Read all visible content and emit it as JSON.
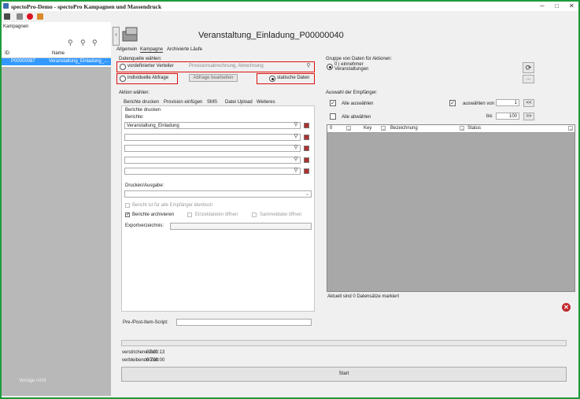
{
  "window": {
    "title": "spectoPro-Demo - spectoPro Kampagnen und Massendruck",
    "minimize": "─",
    "maximize": "□",
    "close": "✕"
  },
  "left": {
    "header": "Kampagnen",
    "col_id": "ID",
    "col_name": "Name",
    "row": {
      "id": "P00000087",
      "name": "Veranstaltung_Einladung_..."
    },
    "footer_link": "Verlage nicht"
  },
  "main": {
    "title": "Veranstaltung_Einladung_P00000040",
    "tabs": [
      "Allgemein",
      "Kampagne",
      "Archivierte Läufe"
    ]
  },
  "datasource": {
    "label": "Datenquelle wählen:",
    "opt_predefined": "vordefinierter Verteiler",
    "predefined_value": "Provisionsabrechnung, Abrechnung",
    "opt_individual": "individuelle Abfrage",
    "edit_query": "Abfrage bearbeiten",
    "opt_static": "statische Daten"
  },
  "group": {
    "label": "Gruppe von Daten für Aktionen:",
    "option": "0 | einnehmer Veranstaltungen",
    "refresh_icon": "refresh-icon",
    "more_button": "..."
  },
  "action": {
    "label": "Aktion wählen:",
    "subtabs": [
      "Berichte drucken",
      "Provision einfügen",
      "SMS",
      "Datei Upload",
      "Weiteres"
    ],
    "section_title": "Berichte drucken",
    "reports_label": "Berichte:",
    "reports": [
      "Veranstaltung_Einladung",
      "",
      "",
      "",
      ""
    ],
    "print_output_label": "Drucken/Ausgabe:",
    "identical_report": "Bericht ist für alle Empfänger identisch",
    "archive_reports": "Berichte archivieren",
    "open_single": "Einzeldateien öffnen",
    "open_collection": "Sammeldatei öffnen",
    "export_dir_label": "Exportverzeichnis:"
  },
  "recipients": {
    "label": "Auswahl der Empfänger:",
    "select_all": "Alle auswählen",
    "deselect_all": "Alle abwählen",
    "select_from_label": "auswählen von",
    "from_value": "1",
    "to_label": "bis",
    "to_value": "100",
    "prev_btn": "<<",
    "next_btn": ">>",
    "columns": [
      "0",
      "Key",
      "Bezeichnung",
      "Status"
    ],
    "status_text": "Aktuell sind 0 Datensätze markiert"
  },
  "bottom": {
    "script_label": "Pre-/Post-Item-Script:",
    "elapsed_label": "verstrichene Zeit:",
    "elapsed_value": "00:00:13",
    "remaining_label": "verbleibende Zeit:",
    "remaining_value": "00:00:00",
    "start_button": "Start"
  },
  "colors": {
    "frame": "#1e9a3c",
    "selection": "#3399ff",
    "highlight_box": "#dd1111",
    "close": "#c0282d"
  }
}
